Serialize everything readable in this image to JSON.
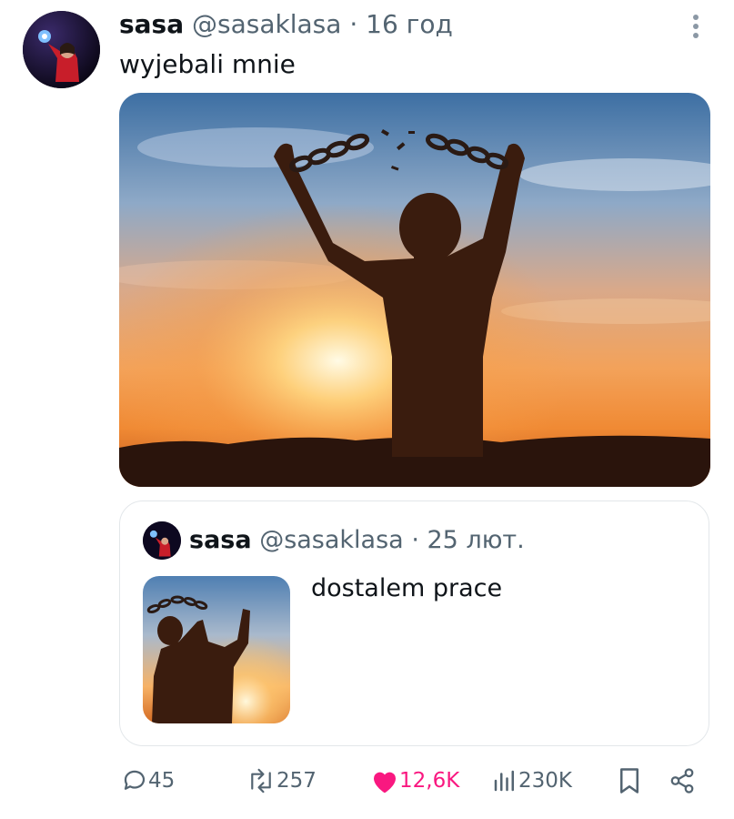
{
  "tweet": {
    "author_name": "sasa",
    "author_handle": "@sasaklasa",
    "separator": "·",
    "time": "16 год",
    "text": "wyjebali mnie",
    "media_icon": "man-breaking-chains-sunset-photo"
  },
  "quoted_tweet": {
    "author_name": "sasa",
    "author_handle": "@sasaklasa",
    "separator": "·",
    "time": "25 лют.",
    "text": "dostalem prace",
    "media_icon": "man-breaking-chains-sunset-thumbnail"
  },
  "actions": {
    "replies": "45",
    "reposts": "257",
    "likes": "12,6K",
    "views": "230K"
  },
  "colors": {
    "text": "#0f1419",
    "muted": "#536471",
    "like": "#f91880",
    "border": "#e3e7ea"
  }
}
